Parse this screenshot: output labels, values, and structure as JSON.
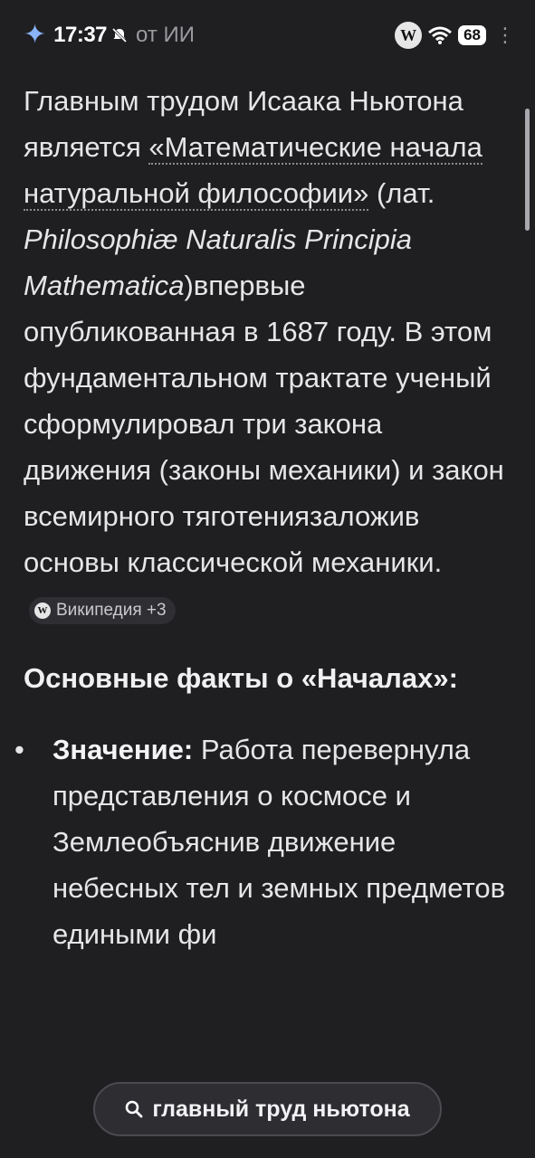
{
  "status_bar": {
    "time": "17:37",
    "overlay_title": "от ИИ",
    "wiki_badge": "W",
    "battery": "68",
    "menu_glyph": "⋮"
  },
  "article": {
    "p1_a": "Главным трудом Исаака Ньютона является ",
    "p1_link": "«Математические начала натуральной философии»",
    "p1_b": " (лат. ",
    "p1_latin": "Philosophiæ Naturalis Principia Mathematica",
    "p1_c": ")впервые опубликованная в 1687 году. В этом фундаментальном трактате ученый сформулировал три закона движения (законы механики) и закон всемирного тяготениязаложив основы классической механики. ",
    "source_chip": "Википедия +3",
    "heading": "Основные факты о «Началах»:",
    "facts": [
      {
        "title": "Значение:",
        "text": " Работа перевернула представления о космосе и Землеобъяснив движение небесных тел и земных предметов едиными фи"
      }
    ]
  },
  "search_pill": {
    "query": "главный труд ньютона"
  },
  "colors": {
    "background": "#1f1f21",
    "text": "#e6e6e8",
    "chip_bg": "#2e2e33",
    "accent_sparkle": "#8ab4f8"
  }
}
